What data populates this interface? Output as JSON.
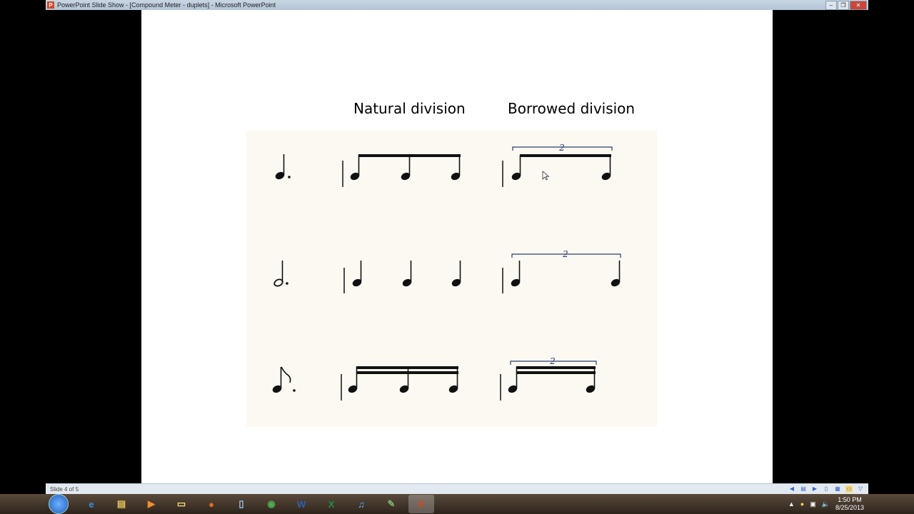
{
  "window": {
    "title": "PowerPoint Slide Show - [Compound Meter - duplets] - Microsoft PowerPoint",
    "app_icon": "P"
  },
  "slide": {
    "headings": {
      "natural": "Natural division",
      "borrowed": "Borrowed division"
    },
    "rows": [
      {
        "beat": "dotted quarter",
        "borrowed_tuplet": "2"
      },
      {
        "beat": "dotted half",
        "borrowed_tuplet": "2"
      },
      {
        "beat": "dotted eighth",
        "borrowed_tuplet": "2"
      }
    ]
  },
  "statusbar": {
    "slide_count": "Slide 4 of 5"
  },
  "taskbar": {
    "apps": [
      {
        "name": "internet-explorer",
        "glyph": "e",
        "color": "#3a8ee6"
      },
      {
        "name": "file-explorer",
        "glyph": "▤",
        "color": "#e8c35a"
      },
      {
        "name": "media-player",
        "glyph": "▶",
        "color": "#f0902a"
      },
      {
        "name": "sticky-notes",
        "glyph": "▭",
        "color": "#f3e27a"
      },
      {
        "name": "firefox",
        "glyph": "●",
        "color": "#e66a1f"
      },
      {
        "name": "notepad",
        "glyph": "▯",
        "color": "#9cc6f0"
      },
      {
        "name": "chrome",
        "glyph": "◉",
        "color": "#4caf50"
      },
      {
        "name": "word",
        "glyph": "W",
        "color": "#2b5fb4"
      },
      {
        "name": "excel",
        "glyph": "X",
        "color": "#1f8f45"
      },
      {
        "name": "itunes",
        "glyph": "♫",
        "color": "#6ab0f0"
      },
      {
        "name": "utility",
        "glyph": "✎",
        "color": "#7cb06a"
      },
      {
        "name": "powerpoint",
        "glyph": "P",
        "color": "#d24726",
        "active": true
      }
    ],
    "clock": {
      "time": "1:50 PM",
      "date": "8/25/2013"
    }
  }
}
